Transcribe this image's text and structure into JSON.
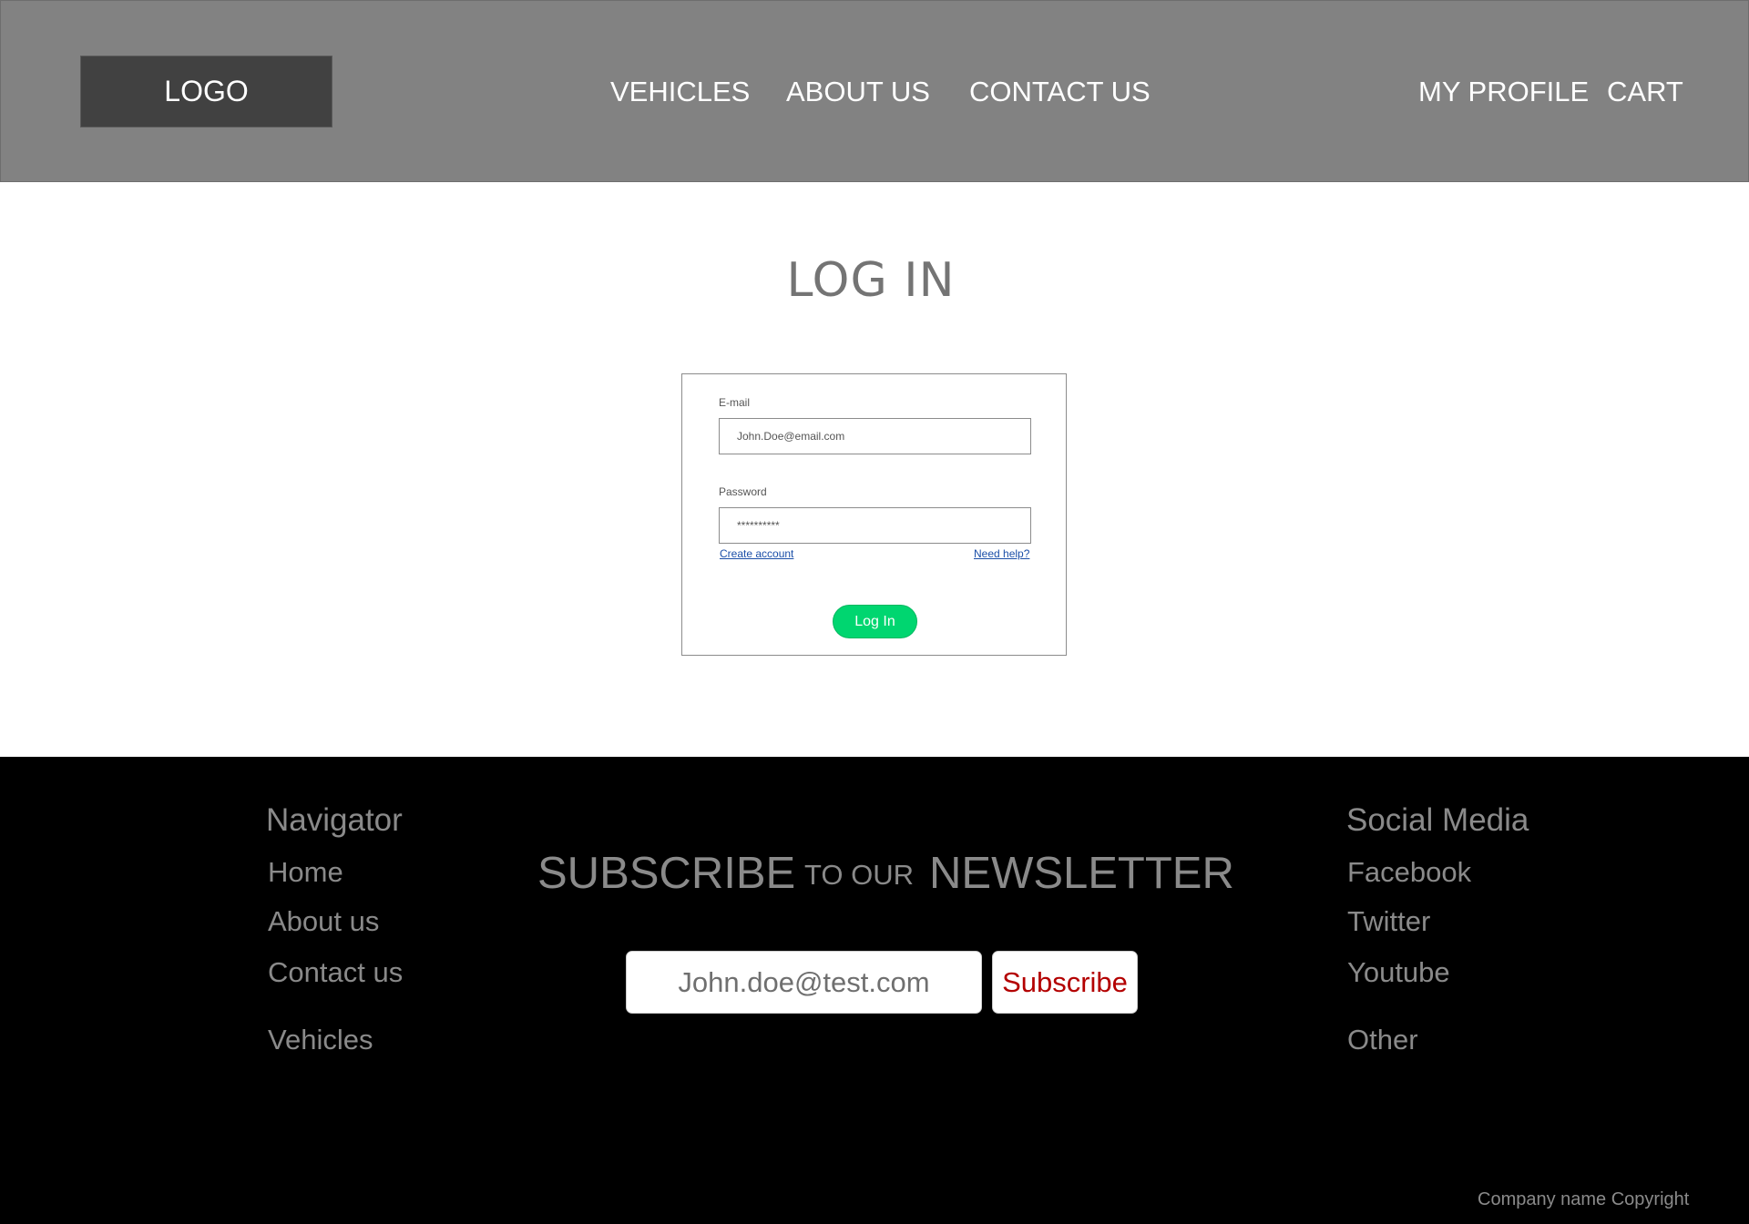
{
  "header": {
    "logo": "LOGO",
    "nav": {
      "vehicles": "VEHICLES",
      "about_us": "ABOUT US",
      "contact_us": "CONTACT US"
    },
    "account": {
      "my_profile": "MY PROFILE",
      "cart": "CART"
    }
  },
  "main": {
    "title": "LOG IN",
    "login_form": {
      "email_label": "E-mail",
      "email_value": "John.Doe@email.com",
      "password_label": "Password",
      "password_value": "**********",
      "create_account": "Create account",
      "need_help": "Need help?",
      "login_button": "Log In"
    }
  },
  "footer": {
    "navigator": {
      "heading": "Navigator",
      "links": [
        "Home",
        "About us",
        "Contact us",
        "Vehicles"
      ]
    },
    "newsletter": {
      "word1": "SUBSCRIBE",
      "word2": "TO OUR",
      "word3": "NEWSLETTER",
      "input_value": "John.doe@test.com",
      "button": "Subscribe"
    },
    "social": {
      "heading": "Social Media",
      "links": [
        "Facebook",
        "Twitter",
        "Youtube",
        "Other"
      ]
    },
    "copyright": "Company name Copyright"
  },
  "colors": {
    "header_bg": "#828282",
    "logo_bg": "#414141",
    "footer_bg": "#000000",
    "login_button": "#00d670",
    "subscribe_text": "#b30000",
    "link": "#1b4fa8"
  }
}
